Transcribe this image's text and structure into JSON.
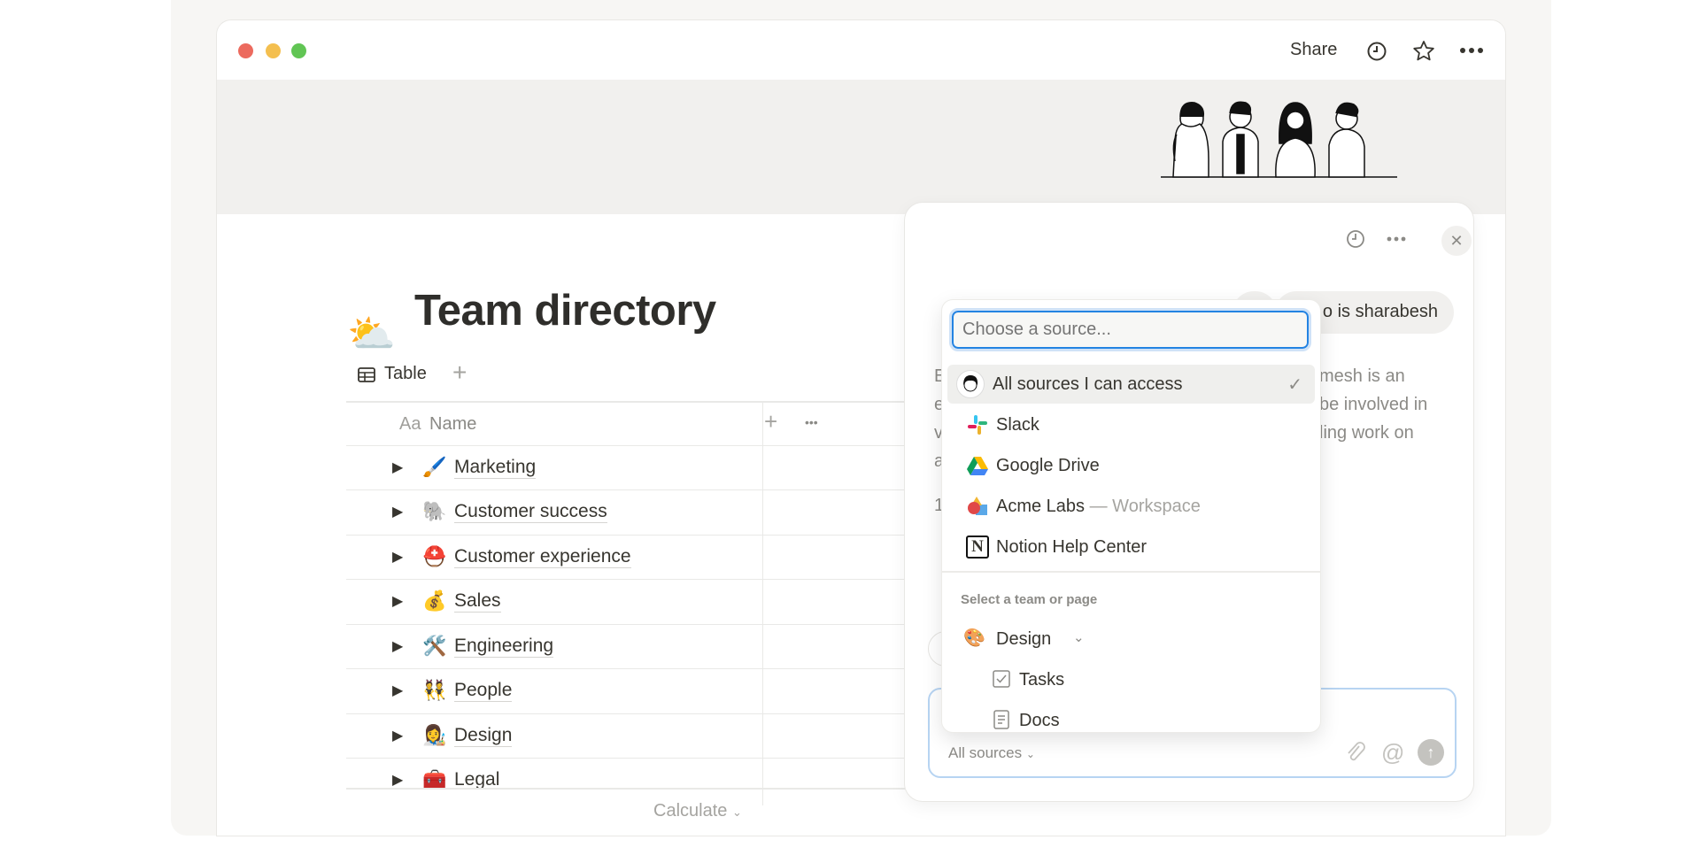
{
  "window": {
    "traffic_lights": [
      "#ec6a5e",
      "#f4bf4f",
      "#61c554"
    ],
    "share_label": "Share",
    "icons": [
      "history-icon",
      "star-icon",
      "more-icon"
    ]
  },
  "page": {
    "title": "Team directory",
    "title_icon": "⛅",
    "view_tab": "Table",
    "add_view": "+"
  },
  "table": {
    "name_header_prefix": "Aa",
    "name_header": "Name",
    "add_column": "+",
    "more": "•••",
    "rows": [
      {
        "emoji": "🖌️",
        "name": "Marketing"
      },
      {
        "emoji": "🐘",
        "name": "Customer success"
      },
      {
        "emoji": "⛑️",
        "name": "Customer experience"
      },
      {
        "emoji": "💰",
        "name": "Sales"
      },
      {
        "emoji": "🛠️",
        "name": "Engineering"
      },
      {
        "emoji": "👯",
        "name": "People"
      },
      {
        "emoji": "👩‍🎨",
        "name": "Design"
      },
      {
        "emoji": "🧰",
        "name": "Legal"
      }
    ],
    "calculate": "Calculate"
  },
  "ai_panel": {
    "chip": "o is sharabesh",
    "response_lines": [
      "mesh is an",
      "be involved in",
      "ling work on"
    ],
    "left_fragments": [
      "E",
      "e",
      "v",
      "a",
      "1"
    ],
    "input": {
      "sources_label": "All sources"
    }
  },
  "source_menu": {
    "placeholder": "Choose a source...",
    "sources": [
      {
        "label": "All sources I can access",
        "selected": true,
        "icon": "avatar-icon"
      },
      {
        "label": "Slack",
        "icon": "slack-icon"
      },
      {
        "label": "Google Drive",
        "icon": "google-drive-icon"
      },
      {
        "label": "Acme Labs",
        "suffix": "— Workspace",
        "icon": "acme-icon"
      },
      {
        "label": "Notion Help Center",
        "icon": "notion-icon"
      }
    ],
    "section_label": "Select a team or page",
    "team": {
      "label": "Design",
      "emoji": "🎨"
    },
    "pages": [
      {
        "label": "Tasks",
        "icon": "checkbox-icon"
      },
      {
        "label": "Docs",
        "icon": "document-icon"
      }
    ]
  },
  "colors": {
    "accent": "#2383e2",
    "input_border": "#b7d4f2"
  }
}
